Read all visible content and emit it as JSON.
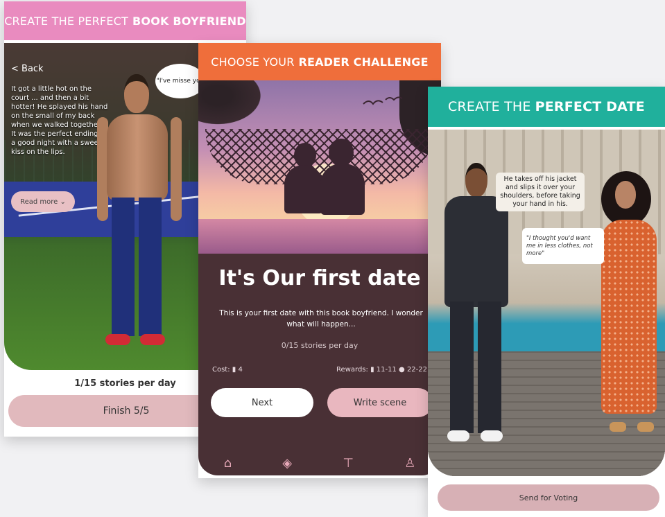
{
  "card1": {
    "banner_plain": "CREATE THE PERFECT",
    "banner_bold": "BOOK BOYFRIEND",
    "back_label": "< Back",
    "story_text": "It got a little hot on the court ... and then a bit hotter! He splayed his hand on the small of my back when we walked together. It was the perfect ending to a good night with a sweet kiss on the lips.",
    "bubble_text": "\"I've misse you",
    "read_more_label": "Read more ⌄",
    "stories_per_day": "1/15 stories per day",
    "finish_label": "Finish 5/5",
    "colors": {
      "banner": "#e98bbf",
      "button": "#e1b9bd"
    }
  },
  "card2": {
    "banner_plain": "CHOOSE YOUR",
    "banner_bold": "READER CHALLENGE",
    "title": "It's Our first date",
    "description": "This is your first date with this book boyfriend.  I wonder what will happen...",
    "stories_per_day": "0/15 stories per day",
    "cost_label": "Cost:",
    "cost_value": "4",
    "rewards_label": "Rewards:",
    "rewards_value_1": "11-11",
    "rewards_value_2": "22-22",
    "next_label": "Next",
    "write_label": "Write scene",
    "tab_icons": [
      "home-icon",
      "shop-icon",
      "lamp-icon",
      "dress-icon"
    ],
    "colors": {
      "banner": "#ef6e3b",
      "panel": "#493035"
    }
  },
  "card3": {
    "banner_plain": "CREATE THE",
    "banner_bold": "PERFECT DATE",
    "narration": "He takes off his jacket and slips it over your shoulders, before taking your hand in his.",
    "quote": "\"I thought you'd want me in less  clothes, not more\"",
    "vote_label": "Send for Voting",
    "colors": {
      "banner": "#20b09c",
      "button": "#d7b0b5"
    }
  }
}
